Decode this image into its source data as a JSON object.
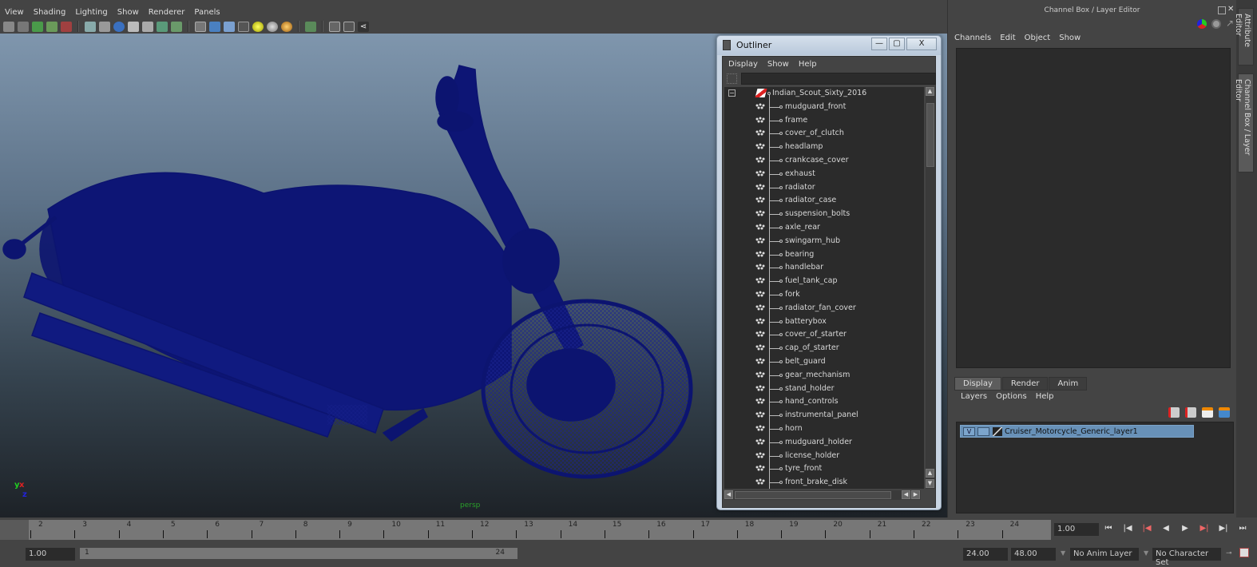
{
  "viewport": {
    "menus": [
      "View",
      "Shading",
      "Lighting",
      "Show",
      "Renderer",
      "Panels"
    ],
    "toolbar_icons": [
      "camera-select-icon",
      "camera-attributes-icon",
      "bookmark-icon",
      "image-plane-icon",
      "grid-toggle-icon",
      "wireframe-icon",
      "film-gate-icon",
      "smooth-shade-icon",
      "flat-shade-icon",
      "xray-icon",
      "isolate-icon",
      "texture-icon",
      "bounding-box-icon",
      "shaded-cube-icon",
      "wire-on-shaded-icon",
      "checker-icon",
      "default-light-icon",
      "gray-sphere-icon",
      "gold-sphere-icon",
      "select-camera-icon",
      "single-view-icon",
      "two-view-icon",
      "node-graph-icon"
    ],
    "camera_label": "persp",
    "axis_labels": {
      "x": "x",
      "y": "y",
      "z": "z"
    }
  },
  "outliner": {
    "title": "Outliner",
    "window_buttons": {
      "minimize": "—",
      "maximize": "▢",
      "close": "X"
    },
    "menus": [
      "Display",
      "Show",
      "Help"
    ],
    "filter_value": "",
    "root": "Indian_Scout_Sixty_2016",
    "items": [
      "mudguard_front",
      "frame",
      "cover_of_clutch",
      "headlamp",
      "crankcase_cover",
      "exhaust",
      "radiator",
      "radiator_case",
      "suspension_bolts",
      "axle_rear",
      "swingarm_hub",
      "bearing",
      "handlebar",
      "fuel_tank_cap",
      "fork",
      "radiator_fan_cover",
      "batterybox",
      "cover_of_starter",
      "cap_of_starter",
      "belt_guard",
      "gear_mechanism",
      "stand_holder",
      "hand_controls",
      "instrumental_panel",
      "horn",
      "mudguard_holder",
      "license_holder",
      "tyre_front",
      "front_brake_disk"
    ]
  },
  "channel_box": {
    "title": "Channel Box / Layer Editor",
    "menus": [
      "Channels",
      "Edit",
      "Object",
      "Show"
    ],
    "layer_tabs": [
      {
        "label": "Display",
        "active": true
      },
      {
        "label": "Render",
        "active": false
      },
      {
        "label": "Anim",
        "active": false
      }
    ],
    "layer_menus": [
      "Layers",
      "Options",
      "Help"
    ],
    "layer": {
      "visibility": "V",
      "type": "",
      "name": "Cruiser_Motorcycle_Generic_layer1"
    },
    "side_tabs": [
      "Attribute Editor",
      "Channel Box / Layer Editor"
    ]
  },
  "timeline": {
    "ticks": [
      "2",
      "3",
      "4",
      "5",
      "6",
      "7",
      "8",
      "9",
      "10",
      "11",
      "12",
      "13",
      "14",
      "15",
      "16",
      "17",
      "18",
      "19",
      "20",
      "21",
      "22",
      "23",
      "24"
    ],
    "current_time": "1.00",
    "start_time": "1.00",
    "range_start": "1",
    "range_end": "24",
    "end_time": "24.00",
    "playback_end": "48.00",
    "anim_layer": "No Anim Layer",
    "character_set": "No Character Set",
    "playback_buttons": [
      "|◀◀",
      "|◀",
      "|◀",
      "◀",
      "▶",
      "▶|",
      "▶|",
      "▶▶|"
    ]
  },
  "colors": {
    "wireframe": "#0c1470",
    "layer_highlight": "#6891b8",
    "camera_label": "#2aa02a"
  }
}
